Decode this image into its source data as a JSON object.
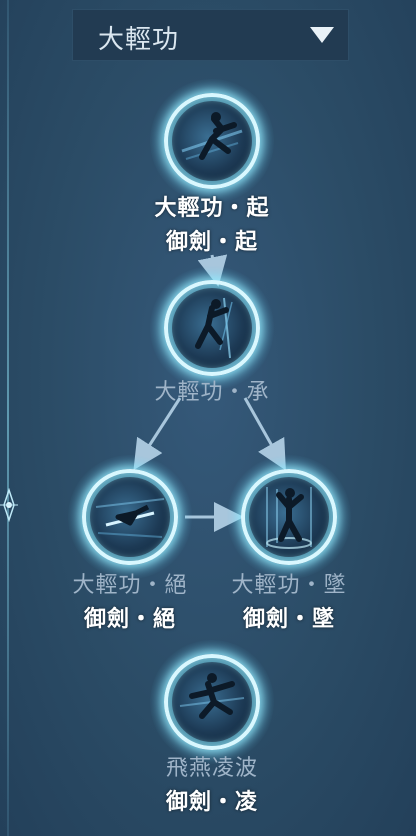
{
  "dropdown": {
    "selected": "大輕功"
  },
  "nodes": {
    "qi": {
      "name": "大輕功・起",
      "sub": "御劍・起",
      "icon": "kick-figure-icon"
    },
    "cheng": {
      "name": "大輕功・承",
      "icon": "dash-figure-icon"
    },
    "jue": {
      "name": "大輕功・絕",
      "sub": "御劍・絕",
      "icon": "sword-glide-icon"
    },
    "zhui": {
      "name": "大輕功・墜",
      "sub": "御劍・墜",
      "icon": "falling-figure-icon"
    },
    "ling": {
      "name": "飛燕凌波",
      "sub": "御劍・凌",
      "icon": "running-figure-icon"
    }
  },
  "colors": {
    "ring": "#d9f8ff",
    "glow": "#6ee6ff",
    "background": "#2b4c66",
    "bright_text": "#ffffff",
    "dim_text": "#9fb4c8"
  }
}
